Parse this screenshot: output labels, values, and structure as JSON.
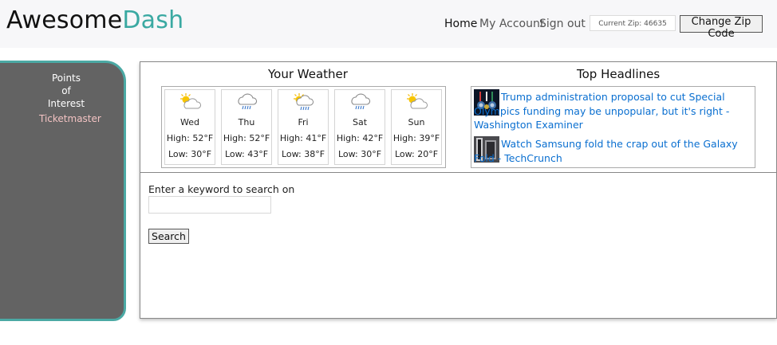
{
  "header": {
    "logo_part1": "Awesome",
    "logo_part2": "Dash",
    "accent_color": "#3aa9a2",
    "nav": {
      "home": "Home",
      "account": "My Account",
      "signout": "Sign out"
    },
    "zip_display": "Current Zip: 46635",
    "change_zip_label": "Change Zip Code"
  },
  "sidebar": {
    "title": "Points of Interest",
    "items": [
      {
        "label": "Ticketmaster"
      }
    ]
  },
  "weather": {
    "title": "Your Weather",
    "days": [
      {
        "name": "Wed",
        "high": "High: 52°F",
        "low": "Low: 30°F",
        "icon": "partly-cloudy-icon"
      },
      {
        "name": "Thu",
        "high": "High: 52°F",
        "low": "Low: 43°F",
        "icon": "rain-icon"
      },
      {
        "name": "Fri",
        "high": "High: 41°F",
        "low": "Low: 38°F",
        "icon": "sun-rain-icon"
      },
      {
        "name": "Sat",
        "high": "High: 42°F",
        "low": "Low: 30°F",
        "icon": "rain-icon"
      },
      {
        "name": "Sun",
        "high": "High: 39°F",
        "low": "Low: 20°F",
        "icon": "partly-cloudy-icon"
      }
    ]
  },
  "headlines": {
    "title": "Top Headlines",
    "items": [
      {
        "text": "Trump administration proposal to cut Special Olympics funding may be unpopular, but it's right - Washington Examiner"
      },
      {
        "text": "Watch Samsung fold the crap out of the Galaxy Fold - TechCrunch"
      }
    ],
    "link_color": "#0a6fd0"
  },
  "search": {
    "label": "Enter a keyword to search on",
    "input_value": "",
    "button_label": "Search"
  }
}
